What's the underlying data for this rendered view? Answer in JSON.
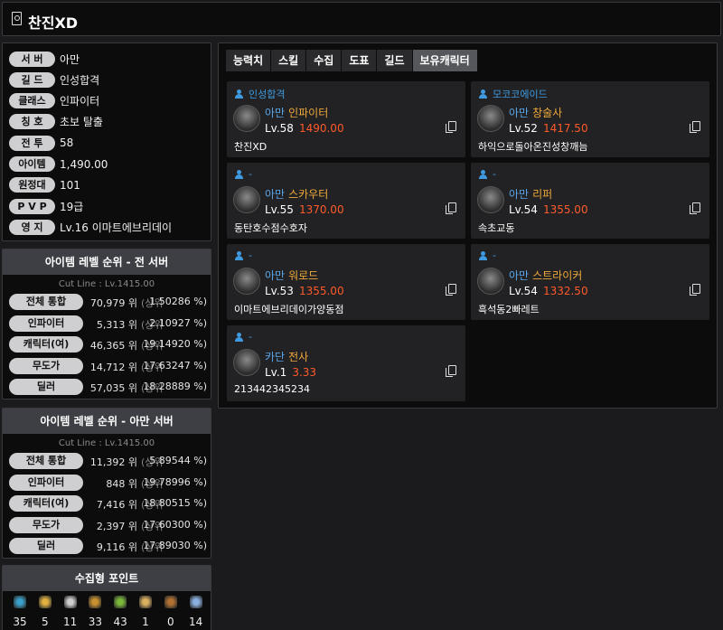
{
  "header": {
    "name": "찬진XD"
  },
  "profile": [
    {
      "label": "서 버",
      "value": "아만"
    },
    {
      "label": "길 드",
      "value": "인성합격"
    },
    {
      "label": "클래스",
      "value": "인파이터"
    },
    {
      "label": "칭 호",
      "value": "초보 탈출"
    },
    {
      "label": "전 투",
      "value": "58"
    },
    {
      "label": "아이템",
      "value": "1,490.00"
    },
    {
      "label": "원정대",
      "value": "101"
    },
    {
      "label": "P V P",
      "value": "19급"
    },
    {
      "label": "영 지",
      "value": "Lv.16 이마트에브리데이"
    }
  ],
  "rank_all": {
    "title": "아이템 레벨 순위 - 전 서버",
    "cutline": "Cut Line : Lv.1415.00",
    "rows": [
      {
        "label": "전체 통합",
        "num": "70,979 위",
        "mid": "(상위",
        "pct": "1.50286 %)"
      },
      {
        "label": "인파이터",
        "num": "5,313 위",
        "mid": "(상위",
        "pct": "2.10927 %)"
      },
      {
        "label": "캐릭터(여)",
        "num": "46,365 위",
        "mid": "(상위",
        "pct": "19.14920 %)"
      },
      {
        "label": "무도가",
        "num": "14,712 위",
        "mid": "(상위",
        "pct": "17.63247 %)"
      },
      {
        "label": "딜러",
        "num": "57,035 위",
        "mid": "(상위",
        "pct": "18.28889 %)"
      }
    ]
  },
  "rank_server": {
    "title": "아이템 레벨 순위 - 아만 서버",
    "cutline": "Cut Line : Lv.1415.00",
    "rows": [
      {
        "label": "전체 통합",
        "num": "11,392 위",
        "mid": "(상위",
        "pct": "5.89544 %)"
      },
      {
        "label": "인파이터",
        "num": "848 위",
        "mid": "(상위",
        "pct": "19.78996 %)"
      },
      {
        "label": "캐릭터(여)",
        "num": "7,416 위",
        "mid": "(상위",
        "pct": "18.80515 %)"
      },
      {
        "label": "무도가",
        "num": "2,397 위",
        "mid": "(상위",
        "pct": "17.60300 %)"
      },
      {
        "label": "딜러",
        "num": "9,116 위",
        "mid": "(상위",
        "pct": "17.89030 %)"
      }
    ]
  },
  "collect": {
    "title": "수집형 포인트",
    "items": [
      {
        "icon": "island-heart-icon",
        "value": "35",
        "color": "#3aa0c8"
      },
      {
        "icon": "star-icon",
        "value": "5",
        "color": "#e0b040"
      },
      {
        "icon": "seed-icon",
        "value": "11",
        "color": "#cfcfcf"
      },
      {
        "icon": "art-icon",
        "value": "33",
        "color": "#c89030"
      },
      {
        "icon": "leaf-icon",
        "value": "43",
        "color": "#7ab83a"
      },
      {
        "icon": "voyage-icon",
        "value": "1",
        "color": "#d8b060"
      },
      {
        "icon": "medal-icon",
        "value": "0",
        "color": "#b07030"
      },
      {
        "icon": "tree-leaf-icon",
        "value": "14",
        "color": "#8ab0e0"
      }
    ]
  },
  "tabs": [
    "능력치",
    "스킬",
    "수집",
    "도표",
    "길드",
    "보유캐릭터"
  ],
  "active_tab": "보유캐릭터",
  "characters": [
    {
      "guild": "인성합격",
      "server": "아만",
      "job": "인파이터",
      "level": "Lv.58",
      "ilvl": "1490.00",
      "name": "찬진XD"
    },
    {
      "guild": "모코코에이드",
      "server": "아만",
      "job": "창술사",
      "level": "Lv.52",
      "ilvl": "1417.50",
      "name": "하익으로돌아온진성창깨늠"
    },
    {
      "guild": "-",
      "server": "아만",
      "job": "스카우터",
      "level": "Lv.55",
      "ilvl": "1370.00",
      "name": "동탄호수점수호자"
    },
    {
      "guild": "-",
      "server": "아만",
      "job": "리퍼",
      "level": "Lv.54",
      "ilvl": "1355.00",
      "name": "속초교동"
    },
    {
      "guild": "-",
      "server": "아만",
      "job": "워로드",
      "level": "Lv.53",
      "ilvl": "1355.00",
      "name": "이마트에브리데이가양동점"
    },
    {
      "guild": "-",
      "server": "아만",
      "job": "스트라이커",
      "level": "Lv.54",
      "ilvl": "1332.50",
      "name": "흑석동2빠레트"
    },
    {
      "guild": "-",
      "server": "카단",
      "job": "전사",
      "level": "Lv.1",
      "ilvl": "3.33",
      "name": "213442345234"
    }
  ],
  "colors": {
    "server_blue": "#5aa6ea",
    "job_orange": "#f0a93a",
    "ilvl_red": "#ff5a2a"
  }
}
